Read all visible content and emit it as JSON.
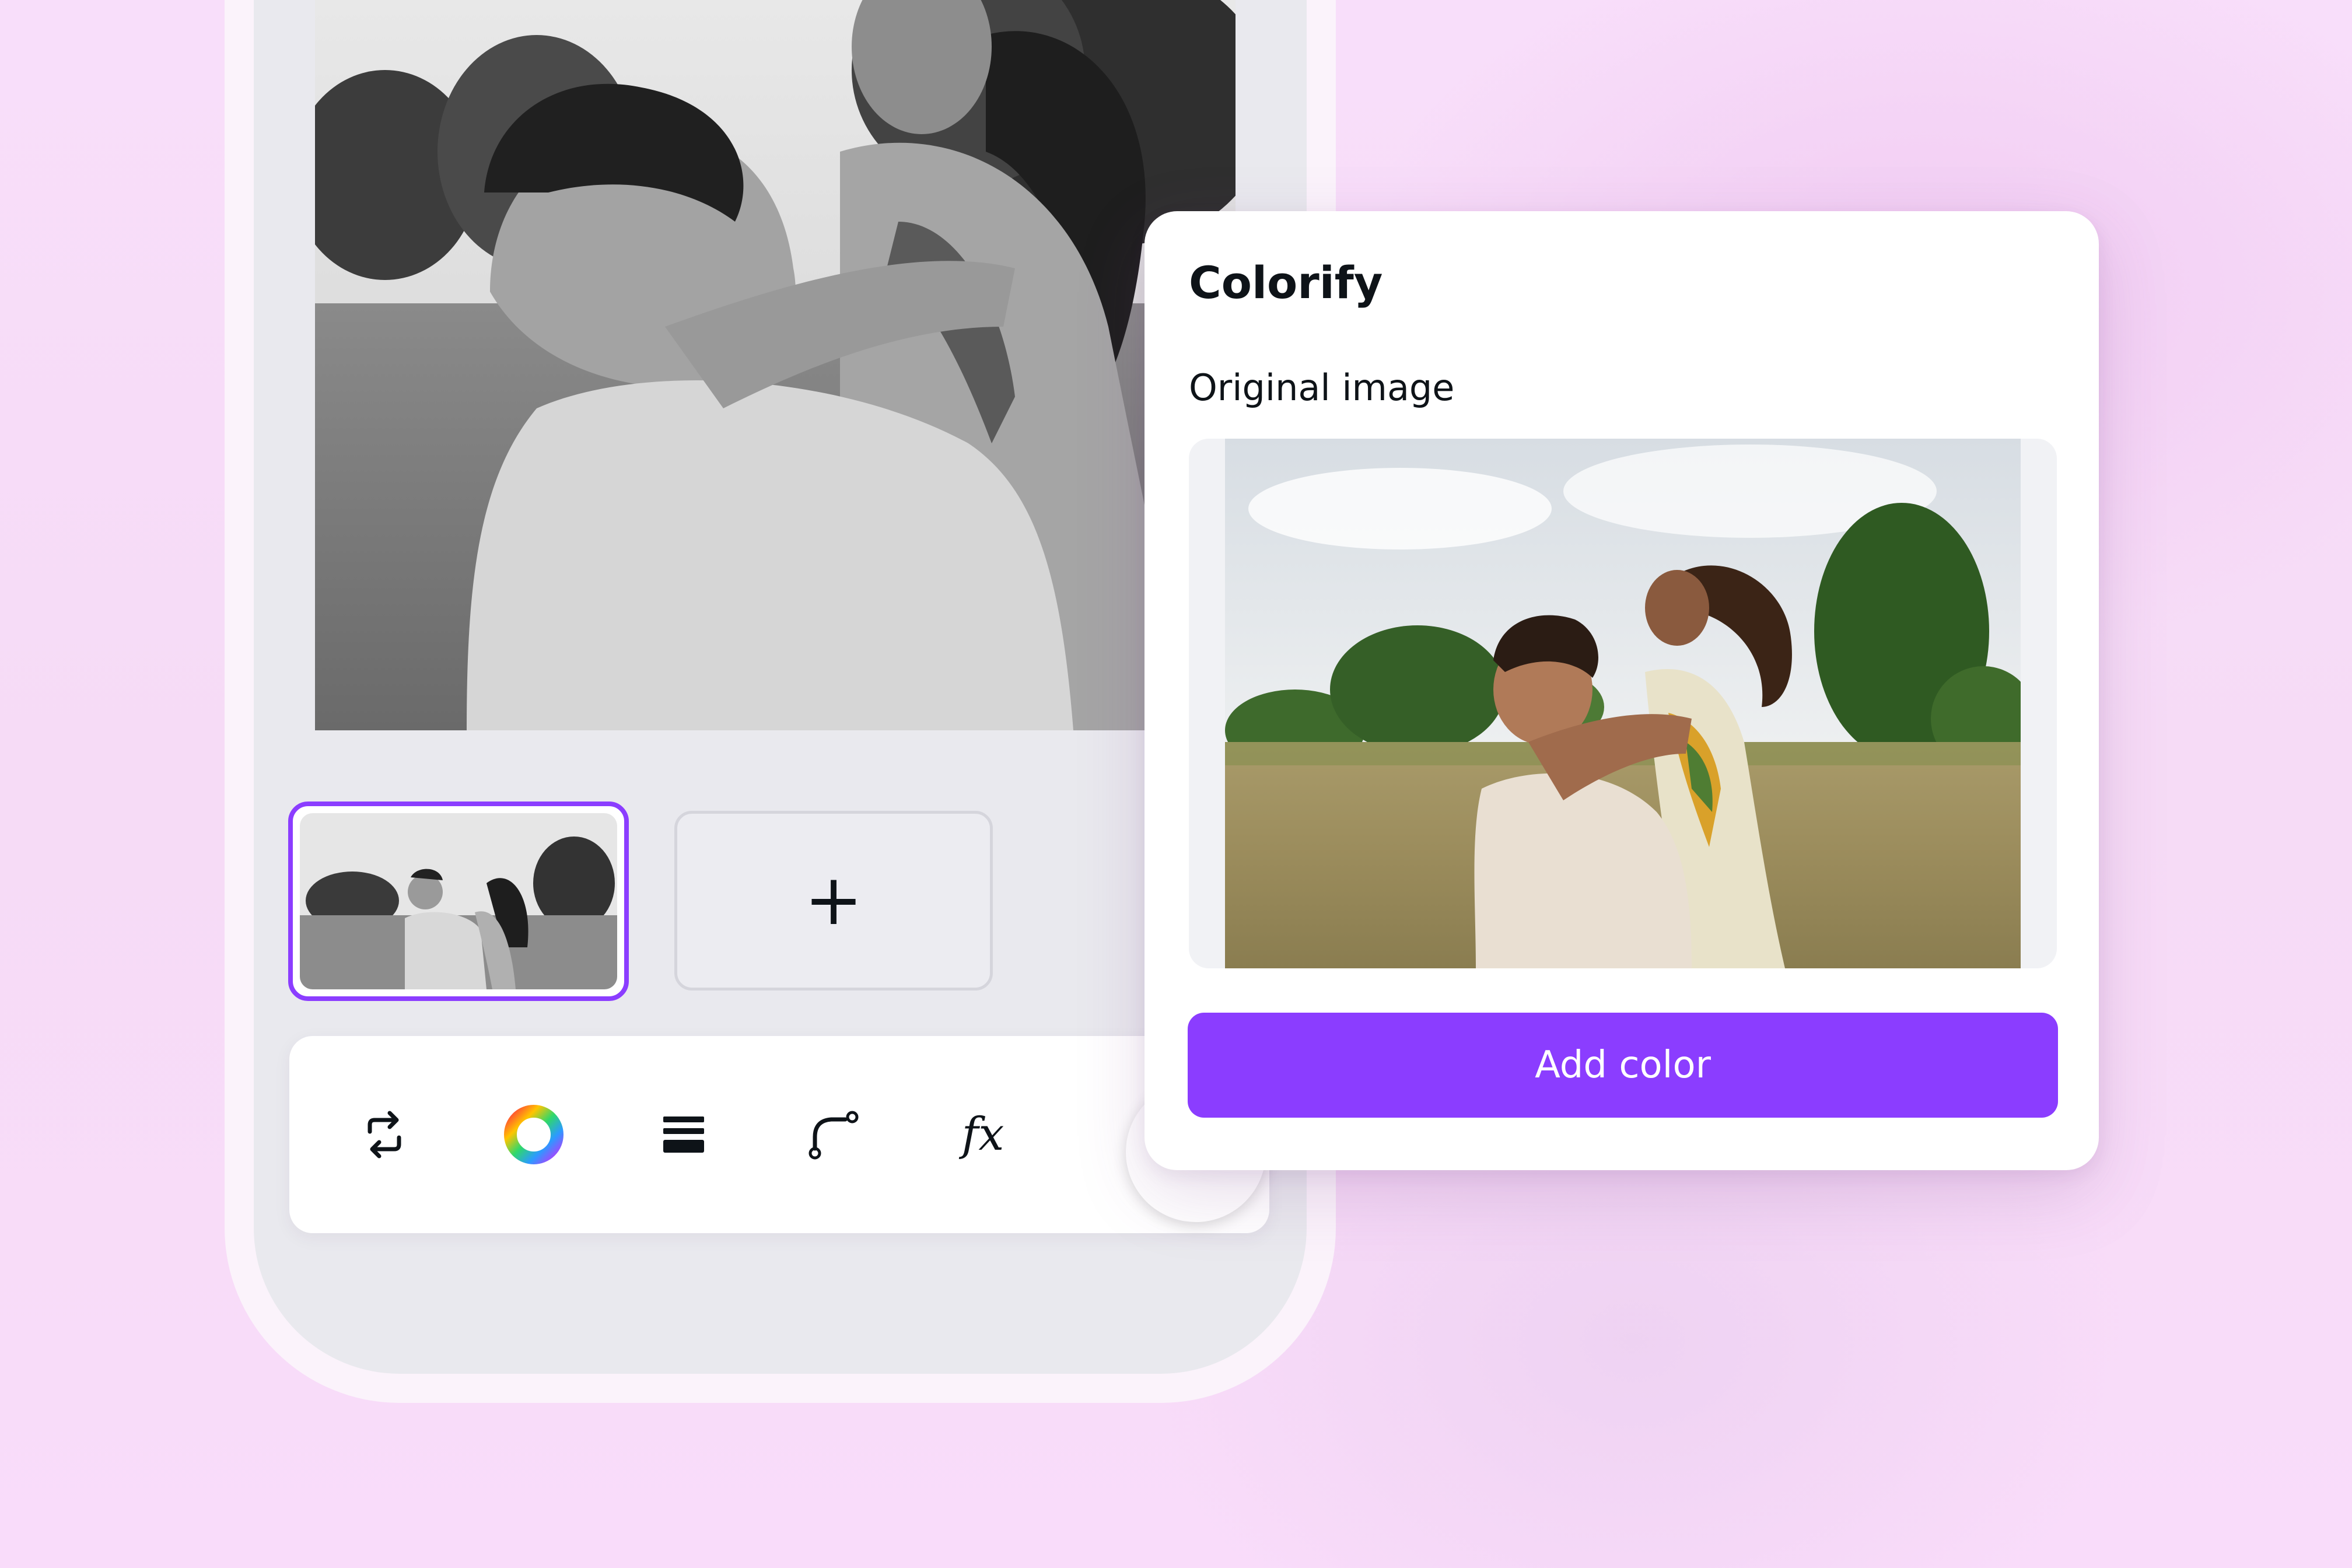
{
  "panel": {
    "title": "Colorify",
    "subtitle": "Original image",
    "cta_label": "Add color"
  },
  "canvas": {
    "add_page_glyph": "+"
  },
  "toolbar": {
    "tools": [
      {
        "icon": "replace-icon"
      },
      {
        "icon": "color-wheel-icon"
      },
      {
        "icon": "position-layers-icon"
      },
      {
        "icon": "path-curve-icon"
      },
      {
        "icon": "effects-fx-icon",
        "label": "fx"
      }
    ]
  },
  "colors": {
    "accent": "#8b3dff",
    "panel_bg": "#ffffff",
    "screen_bg": "#e9e9ee",
    "text": "#0e1318"
  }
}
